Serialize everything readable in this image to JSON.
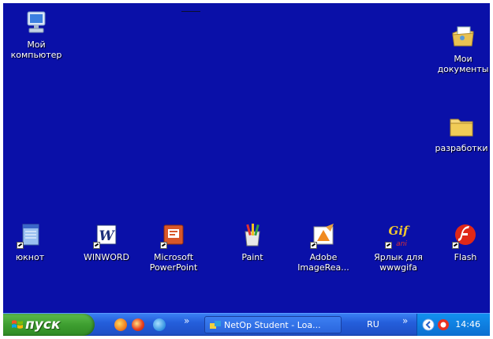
{
  "desktop": {
    "icons": [
      {
        "label": "Мой\nкомпьютер",
        "icon": "my-computer-icon"
      },
      {
        "label": "Мои\nдокументы",
        "icon": "my-documents-icon"
      },
      {
        "label": "разработки",
        "icon": "folder-icon"
      },
      {
        "label": "юкнот",
        "icon": "notepad-icon"
      },
      {
        "label": "WINWORD",
        "icon": "word-icon"
      },
      {
        "label": "Microsoft\nPowerPoint",
        "icon": "powerpoint-icon"
      },
      {
        "label": "Paint",
        "icon": "paint-icon"
      },
      {
        "label": "Adobe\nImageRea...",
        "icon": "imageready-icon"
      },
      {
        "label": "Ярлык для\nwwwgifa",
        "icon": "gif-icon"
      },
      {
        "label": "Flash",
        "icon": "flash-icon"
      }
    ]
  },
  "taskbar": {
    "start_label": "пуск",
    "task_label": "NetOp Student - Loa...",
    "lang": "RU",
    "time": "14:46",
    "chevron": "»"
  },
  "colors": {
    "desktop": "#0a10a8",
    "start_button": "#3e9e30",
    "taskbar": "#245edb",
    "tray": "#0f7fe0"
  }
}
